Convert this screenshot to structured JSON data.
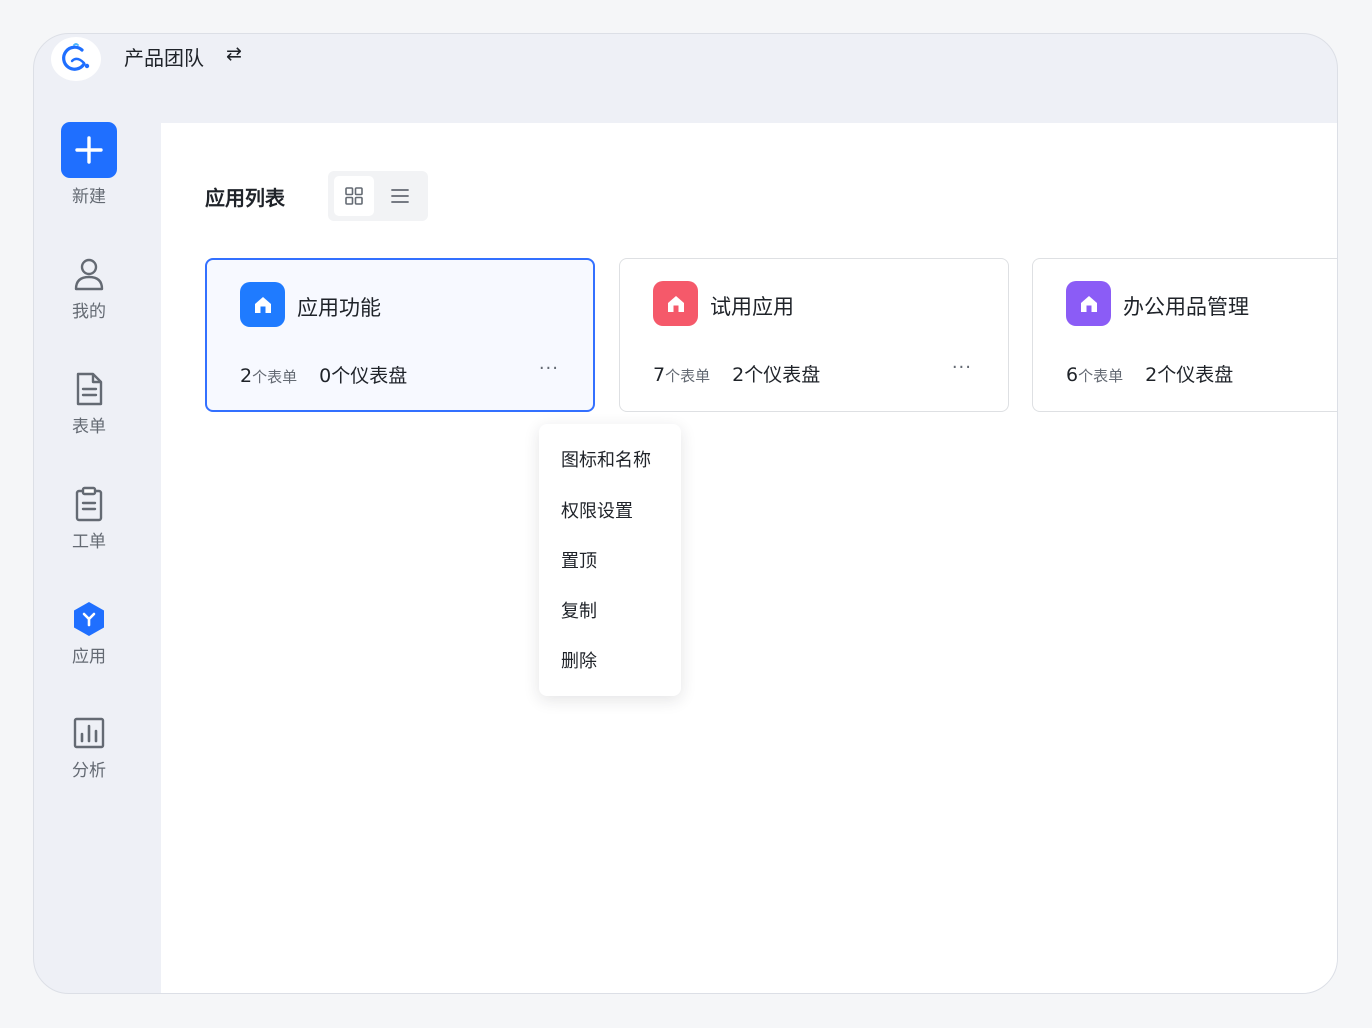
{
  "header": {
    "team_name": "产品团队",
    "switch_icon": "swap-arrows-icon",
    "logo_icon": "logo-icon"
  },
  "sidebar": {
    "items": [
      {
        "label": "新建",
        "icon": "plus-icon"
      },
      {
        "label": "我的",
        "icon": "user-icon"
      },
      {
        "label": "表单",
        "icon": "document-icon"
      },
      {
        "label": "工单",
        "icon": "clipboard-icon"
      },
      {
        "label": "应用",
        "icon": "hexagon-app-icon"
      },
      {
        "label": "分析",
        "icon": "bar-chart-icon"
      }
    ]
  },
  "main": {
    "title": "应用列表",
    "view_toggle": {
      "grid_icon": "grid-view-icon",
      "list_icon": "list-view-icon",
      "active": "grid"
    },
    "cards": [
      {
        "name": "应用功能",
        "forms_count": "2",
        "forms_unit": "个表单",
        "dashboards": "0个仪表盘",
        "more": "···",
        "color": "#1f7bff",
        "icon": "home-icon"
      },
      {
        "name": "试用应用",
        "forms_count": "7",
        "forms_unit": "个表单",
        "dashboards": "2个仪表盘",
        "more": "···",
        "color": "#f5596a",
        "icon": "home-icon"
      },
      {
        "name": "办公用品管理",
        "forms_count": "6",
        "forms_unit": "个表单",
        "dashboards": "2个仪表盘",
        "more": "",
        "color": "#8b5cf6",
        "icon": "home-icon"
      }
    ]
  },
  "context_menu": {
    "items": [
      "图标和名称",
      "权限设置",
      "置顶",
      "复制",
      "删除"
    ]
  },
  "colors": {
    "accent": "#1f6fff",
    "selected_border": "#3370ff"
  }
}
